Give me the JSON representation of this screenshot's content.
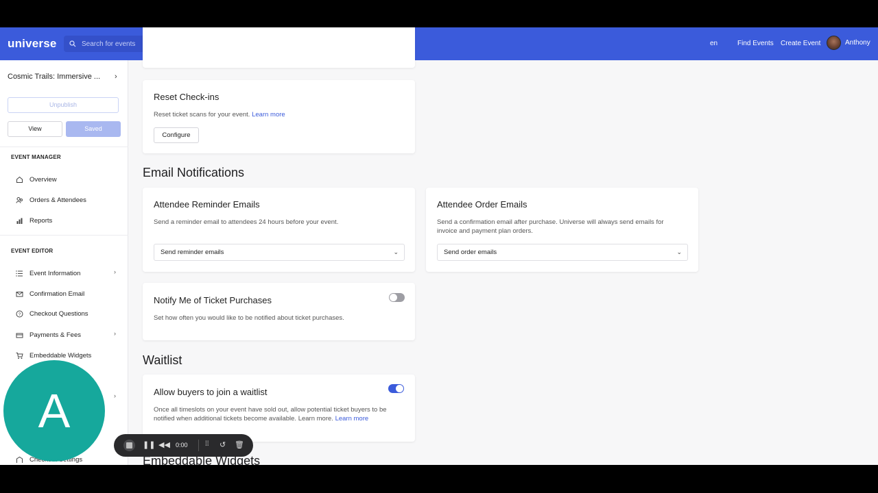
{
  "header": {
    "logo": "universe",
    "search_placeholder": "Search for events",
    "lang": "en",
    "find_events": "Find Events",
    "create_event": "Create Event",
    "user_name": "Anthony"
  },
  "sidebar": {
    "event_title": "Cosmic Trails: Immersive ...",
    "unpublish": "Unpublish",
    "view": "View",
    "saved": "Saved",
    "event_manager_title": "EVENT MANAGER",
    "manager_items": [
      {
        "label": "Overview",
        "icon": "home-icon"
      },
      {
        "label": "Orders & Attendees",
        "icon": "attendees-icon"
      },
      {
        "label": "Reports",
        "icon": "bar-chart-icon"
      }
    ],
    "event_editor_title": "EVENT EDITOR",
    "editor_items": [
      {
        "label": "Event Information",
        "icon": "list-icon"
      },
      {
        "label": "Confirmation Email",
        "icon": "mail-icon"
      },
      {
        "label": "Checkout Questions",
        "icon": "question-icon"
      },
      {
        "label": "Payments & Fees",
        "icon": "payment-icon"
      },
      {
        "label": "Embeddable Widgets",
        "icon": "cart-icon"
      },
      {
        "label": "Checkout Settings",
        "icon": "settings-icon"
      }
    ]
  },
  "main": {
    "reset_checkins": {
      "title": "Reset Check-ins",
      "text": "Reset ticket scans for your event.",
      "link": "Learn more",
      "button": "Configure"
    },
    "email_notifications_heading": "Email Notifications",
    "reminder": {
      "title": "Attendee Reminder Emails",
      "text": "Send a reminder email to attendees 24 hours before your event.",
      "select_value": "Send reminder emails"
    },
    "order_emails": {
      "title": "Attendee Order Emails",
      "text_line1": "Send a confirmation email after purchase. Universe will always send emails for",
      "text_line2": "invoice and payment plan orders.",
      "select_value": "Send order emails"
    },
    "notify": {
      "title": "Notify Me of Ticket Purchases",
      "text": "Set how often you would like to be notified about ticket purchases.",
      "toggle_on": false
    },
    "waitlist_heading": "Waitlist",
    "waitlist": {
      "title": "Allow buyers to join a waitlist",
      "text_line1": "Once all timeslots on your event have sold out, allow potential ticket buyers to be",
      "text_line2": "notified when additional tickets become available. Learn more.",
      "link": "Learn more",
      "toggle_on": true
    },
    "embeddable_heading": "Embeddable Widgets"
  },
  "overlay": {
    "avatar_letter": "A",
    "timer": "0:00"
  },
  "colors": {
    "brand": "#3b5bdb",
    "overlay_avatar": "#16a89c"
  }
}
